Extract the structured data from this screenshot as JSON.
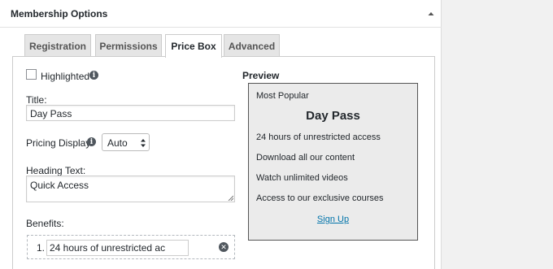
{
  "metabox": {
    "title": "Membership Options",
    "collapse_icon": "triangle-up-icon"
  },
  "tabs": [
    {
      "label": "Registration",
      "active": false
    },
    {
      "label": "Permissions",
      "active": false
    },
    {
      "label": "Price Box",
      "active": true
    },
    {
      "label": "Advanced",
      "active": false
    }
  ],
  "form": {
    "highlighted": {
      "label": "Highlighted",
      "checked": false
    },
    "title": {
      "label": "Title:",
      "value": "Day Pass"
    },
    "pricing_display": {
      "label": "Pricing Display",
      "selected": "Auto"
    },
    "heading_text": {
      "label": "Heading Text:",
      "value": "Quick Access"
    },
    "benefits": {
      "label": "Benefits:",
      "items": [
        {
          "number": "1.",
          "value": "24 hours of unrestricted ac"
        }
      ]
    }
  },
  "preview": {
    "heading": "Preview",
    "badge": "Most Popular",
    "title": "Day Pass",
    "benefits": [
      "24 hours of unrestricted access",
      "Download all our content",
      "Watch unlimited videos",
      "Access to our exclusive courses"
    ],
    "button_label": "Sign Up"
  }
}
